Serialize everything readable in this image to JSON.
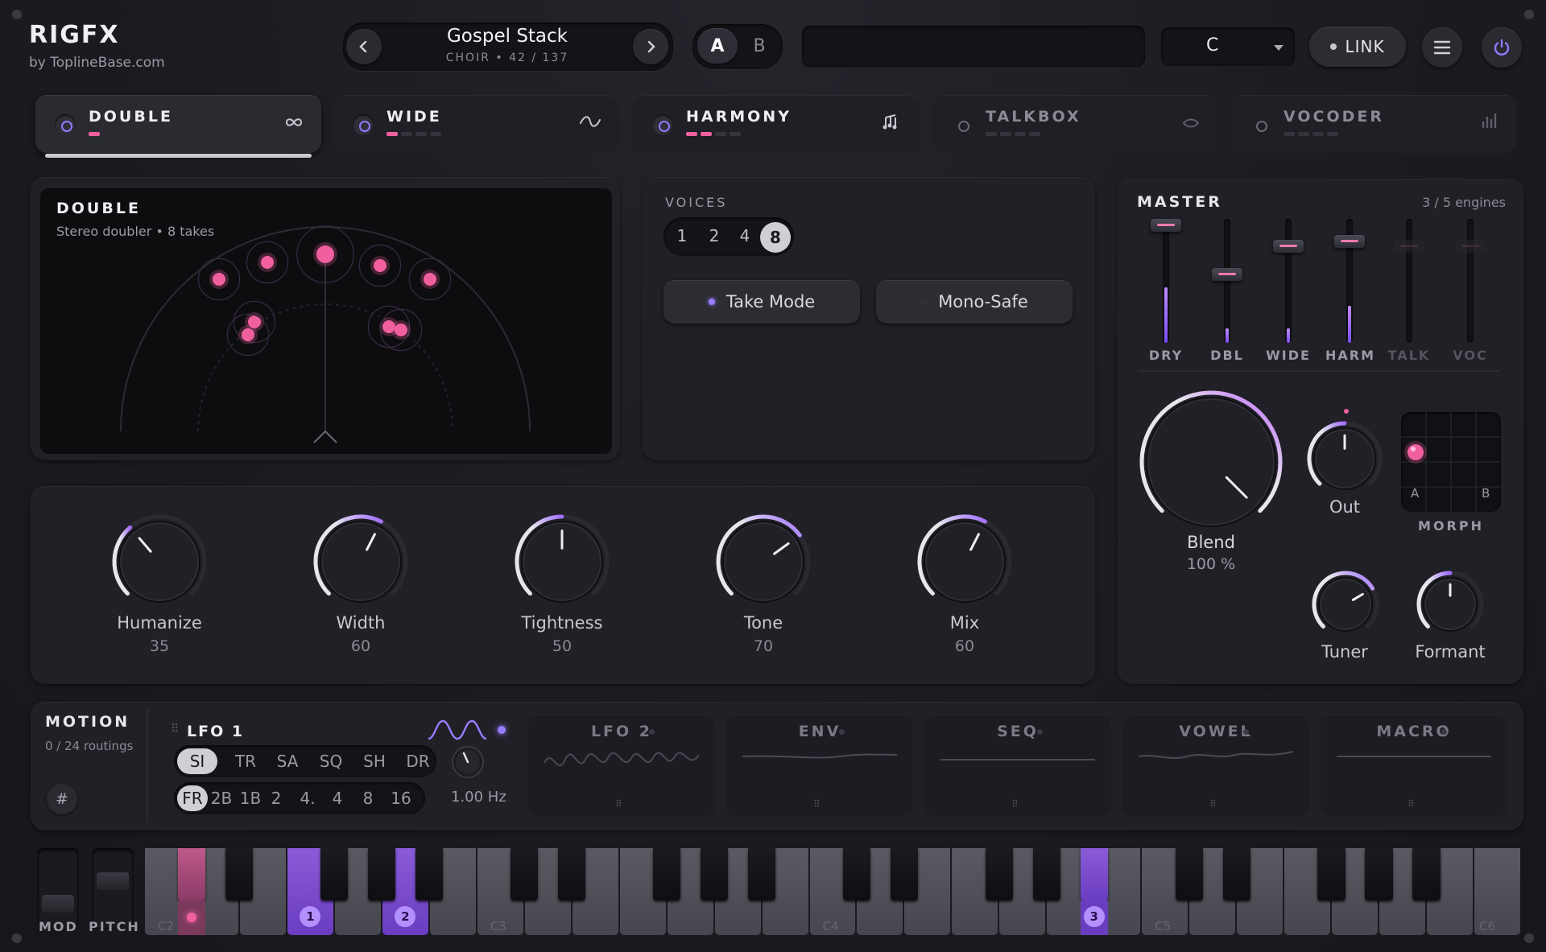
{
  "brand": {
    "name": "RIGFX",
    "byline": "by ToplineBase.com"
  },
  "preset": {
    "name": "Gospel Stack",
    "subtitle": "CHOIR • 42 / 137"
  },
  "ab": {
    "a": "A",
    "b": "B",
    "selected": "A"
  },
  "key_select": {
    "value": "C"
  },
  "link": {
    "label": "LINK"
  },
  "engines": [
    {
      "label": "DOUBLE",
      "icon": "infinity-icon",
      "active": true,
      "enabled": true,
      "meter": 1
    },
    {
      "label": "WIDE",
      "icon": "wave-icon",
      "active": false,
      "enabled": true,
      "meter": 1
    },
    {
      "label": "HARMONY",
      "icon": "notes-icon",
      "active": false,
      "enabled": true,
      "meter": 2
    },
    {
      "label": "TALKBOX",
      "icon": "mouth-icon",
      "active": false,
      "enabled": false,
      "meter": 0
    },
    {
      "label": "VOCODER",
      "icon": "bars-icon",
      "active": false,
      "enabled": false,
      "meter": 0
    }
  ],
  "double": {
    "title": "DOUBLE",
    "subtitle": "Stereo doubler • 8 takes",
    "voices": {
      "label": "VOICES",
      "options": [
        "1",
        "2",
        "4",
        "8"
      ],
      "selected": "8"
    },
    "take_mode": {
      "label": "Take Mode",
      "on": true
    },
    "mono_safe": {
      "label": "Mono-Safe",
      "on": false
    },
    "knobs": [
      {
        "label": "Humanize",
        "value": "35",
        "fraction": 0.35
      },
      {
        "label": "Width",
        "value": "60",
        "fraction": 0.6
      },
      {
        "label": "Tightness",
        "value": "50",
        "fraction": 0.5
      },
      {
        "label": "Tone",
        "value": "70",
        "fraction": 0.7
      },
      {
        "label": "Mix",
        "value": "60",
        "fraction": 0.6
      }
    ]
  },
  "master": {
    "title": "MASTER",
    "engines_count": "3 / 5 engines",
    "faders": [
      {
        "label": "DRY",
        "level": 0.95,
        "meter": 0.45,
        "active": true
      },
      {
        "label": "DBL",
        "level": 0.55,
        "meter": 0.12,
        "active": true
      },
      {
        "label": "WIDE",
        "level": 0.78,
        "meter": 0.12,
        "active": true
      },
      {
        "label": "HARM",
        "level": 0.82,
        "meter": 0.3,
        "active": true
      },
      {
        "label": "TALK",
        "level": 0.78,
        "meter": 0,
        "active": false
      },
      {
        "label": "VOC",
        "level": 0.78,
        "meter": 0,
        "active": false
      }
    ],
    "blend": {
      "label": "Blend",
      "value": "100 %",
      "fraction": 1.0
    },
    "out": {
      "label": "Out",
      "fraction": 0.5
    },
    "tuner": {
      "label": "Tuner",
      "fraction": 0.72
    },
    "formant": {
      "label": "Formant",
      "fraction": 0.5
    },
    "morph": {
      "label": "MORPH",
      "a": "A",
      "b": "B"
    }
  },
  "motion": {
    "title": "MOTION",
    "routings": "0 / 24 routings",
    "lfo1": {
      "title": "LFO 1",
      "shapes": [
        "SI",
        "TR",
        "SA",
        "SQ",
        "SH",
        "DR"
      ],
      "shape_selected": "SI",
      "divisions": [
        "FR",
        "2B",
        "1B",
        "2",
        "4.",
        "4",
        "8",
        "16"
      ],
      "division_selected": "FR",
      "rate": "1.00 Hz"
    },
    "slots": [
      "LFO 2",
      "ENV",
      "SEQ",
      "VOWEL",
      "MACRO"
    ]
  },
  "keyboard": {
    "wheels": [
      "MOD",
      "PITCH"
    ],
    "octave_labels": [
      "C2",
      "C3",
      "C4",
      "C5",
      "C6"
    ],
    "voice_markers": [
      "1",
      "2",
      "3"
    ]
  },
  "colors": {
    "accent_pink": "#f0609e",
    "accent_purple": "#8f6cff",
    "panel": "#202026"
  }
}
